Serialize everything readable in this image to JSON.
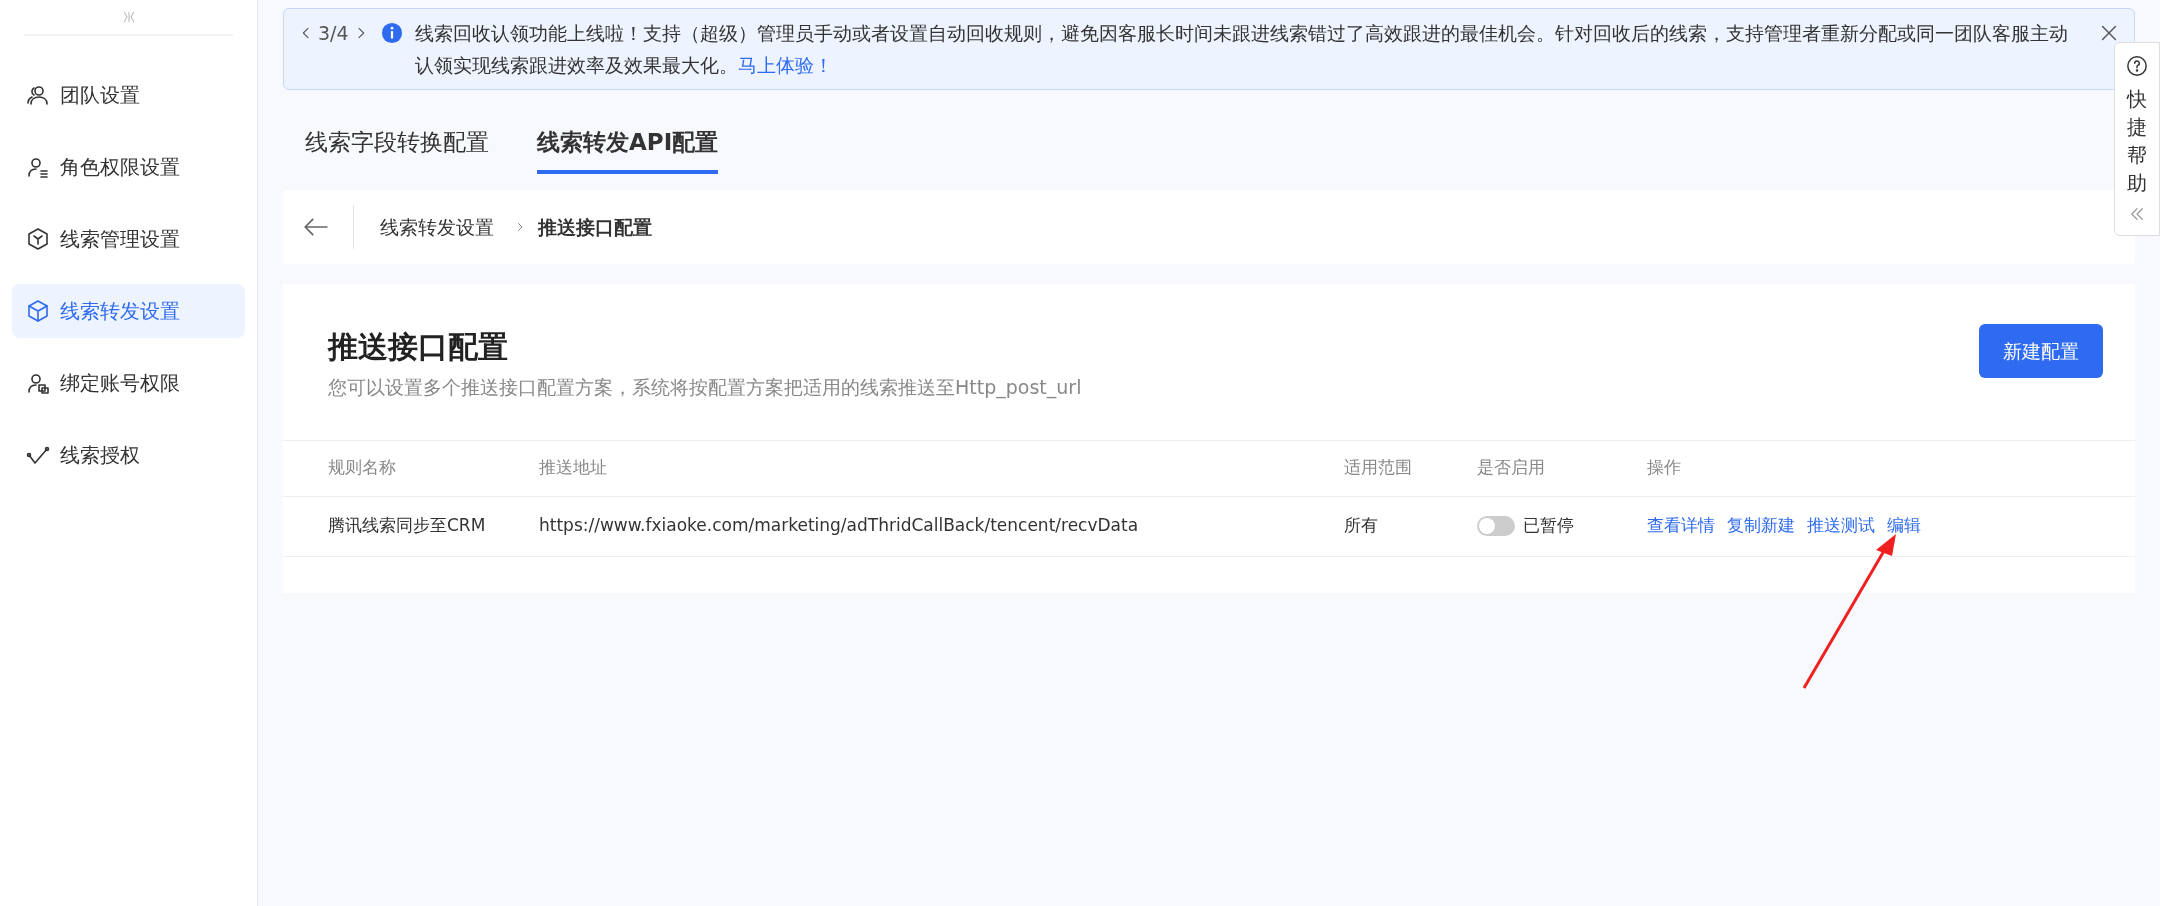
{
  "sidebar": {
    "items": [
      {
        "label": "团队设置",
        "selected": false
      },
      {
        "label": "角色权限设置",
        "selected": false
      },
      {
        "label": "线索管理设置",
        "selected": false
      },
      {
        "label": "线索转发设置",
        "selected": true
      },
      {
        "label": "绑定账号权限",
        "selected": false
      },
      {
        "label": "线索授权",
        "selected": false
      }
    ]
  },
  "banner": {
    "pager": "3/4",
    "text": "线索回收认领功能上线啦！支持（超级）管理员手动或者设置自动回收规则，避免因客服长时间未跟进线索错过了高效跟进的最佳机会。针对回收后的线索，支持管理者重新分配或同一团队客服主动认领实现线索跟进效率及效果最大化。",
    "link": "马上体验！"
  },
  "tabs": [
    {
      "label": "线索字段转换配置",
      "selected": false
    },
    {
      "label": "线索转发API配置",
      "selected": true
    }
  ],
  "breadcrumb": [
    "线索转发设置",
    "推送接口配置"
  ],
  "card": {
    "title": "推送接口配置",
    "subtitle": "您可以设置多个推送接口配置方案，系统将按配置方案把适用的线索推送至Http_post_url",
    "button": "新建配置"
  },
  "table": {
    "columns": [
      "规则名称",
      "推送地址",
      "适用范围",
      "是否启用",
      "操作"
    ],
    "rows": [
      {
        "name": "腾讯线索同步至CRM",
        "url": "https://www.fxiaoke.com/marketing/adThridCallBack/tencent/recvData",
        "scope": "所有",
        "on": false,
        "status": "已暂停",
        "actions": [
          "查看详情",
          "复制新建",
          "推送测试",
          "编辑"
        ]
      }
    ]
  },
  "help": {
    "label": "快捷帮助"
  }
}
